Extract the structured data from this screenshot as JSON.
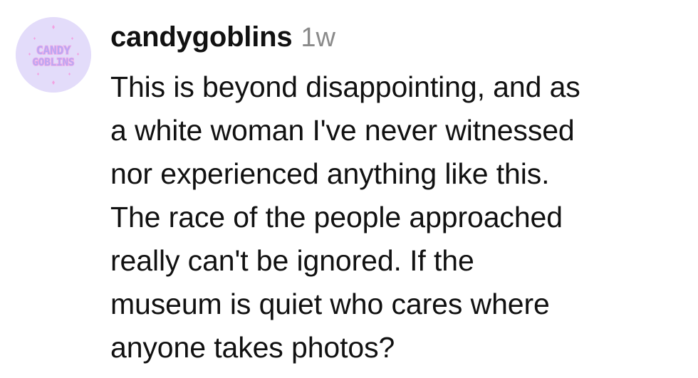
{
  "comment": {
    "avatar": {
      "icon": "candy-goblins-logo",
      "logo_text": [
        "CANDY",
        "GOBLINS"
      ],
      "colors": {
        "background": "#e3dcfa",
        "text_fill": "#b9a8f3",
        "text_outline": "#f2a8e6",
        "sparkle": "#f3a2e2"
      }
    },
    "username": "candygoblins",
    "timestamp": "1w",
    "text_lines": [
      "This is beyond disappointing, and as",
      "a white woman I've never witnessed",
      "nor experienced anything like this.",
      "The race of the people approached",
      "really can't be ignored. If the",
      "museum is quiet who cares where",
      "anyone takes photos?"
    ]
  }
}
